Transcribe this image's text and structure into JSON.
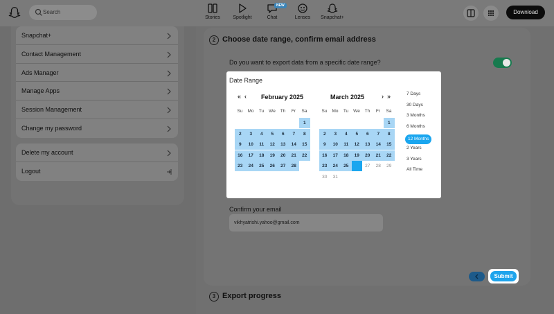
{
  "topbar": {
    "search_placeholder": "Search",
    "nav": [
      {
        "label": "Stories",
        "icon": "stories-icon"
      },
      {
        "label": "Spotlight",
        "icon": "spotlight-icon"
      },
      {
        "label": "Chat",
        "icon": "chat-icon",
        "badge": "NEW"
      },
      {
        "label": "Lenses",
        "icon": "lenses-icon"
      },
      {
        "label": "Snapchat+",
        "icon": "snapchat-plus-icon"
      }
    ],
    "download_label": "Download"
  },
  "sidebar": {
    "group1": [
      "Snapchat+",
      "Contact Management",
      "Ads Manager",
      "Manage Apps",
      "Session Management",
      "Change my password"
    ],
    "group2": [
      "Delete my account",
      "Logout"
    ]
  },
  "export": {
    "step2_number": "2",
    "step2_title": "Choose date range, confirm email address",
    "question": "Do you want to export data from a specific date range?",
    "toggle_on": true,
    "confirm_label": "Confirm your email",
    "email_value": "vikhyatrishi.yahoo@gmail.com",
    "submit_label": "Submit",
    "step3_number": "3",
    "step3_title": "Export progress"
  },
  "date_range": {
    "title": "Date Range",
    "weekdays": [
      "Su",
      "Mo",
      "Tu",
      "We",
      "Th",
      "Fr",
      "Sa"
    ],
    "left_month": {
      "title": "February 2025",
      "weeks": [
        [
          "",
          "",
          "",
          "",
          "",
          "",
          "1"
        ],
        [
          "2",
          "3",
          "4",
          "5",
          "6",
          "7",
          "8"
        ],
        [
          "9",
          "10",
          "11",
          "12",
          "13",
          "14",
          "15"
        ],
        [
          "16",
          "17",
          "18",
          "19",
          "20",
          "21",
          "22"
        ],
        [
          "23",
          "24",
          "25",
          "26",
          "27",
          "28",
          ""
        ]
      ]
    },
    "right_month": {
      "title": "March 2025",
      "weeks": [
        [
          "",
          "",
          "",
          "",
          "",
          "",
          "1"
        ],
        [
          "2",
          "3",
          "4",
          "5",
          "6",
          "7",
          "8"
        ],
        [
          "9",
          "10",
          "11",
          "12",
          "13",
          "14",
          "15"
        ],
        [
          "16",
          "17",
          "18",
          "19",
          "20",
          "21",
          "22"
        ],
        [
          "23",
          "24",
          "25",
          "26",
          "27",
          "28",
          "29"
        ],
        [
          "30",
          "31",
          "",
          "",
          "",
          "",
          ""
        ]
      ],
      "last_selected_day": "26"
    },
    "presets": [
      "7 Days",
      "30 Days",
      "3 Months",
      "6 Months",
      "12 Months",
      "2 Years",
      "3 Years",
      "All Time"
    ],
    "active_preset": "12 Months"
  },
  "colors": {
    "selected_range": "#a8d6f5",
    "accent": "#1aa6ef",
    "toggle_on": "#177a4e"
  }
}
